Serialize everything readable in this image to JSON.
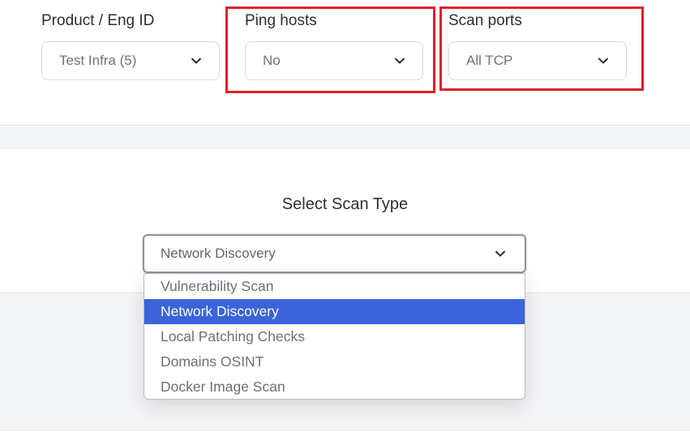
{
  "filters": {
    "product": {
      "label": "Product / Eng ID",
      "value": "Test Infra (5)"
    },
    "ping_hosts": {
      "label": "Ping hosts",
      "value": "No"
    },
    "scan_ports": {
      "label": "Scan ports",
      "value": "All TCP"
    }
  },
  "scan_type": {
    "title": "Select Scan Type",
    "selected": "Network Discovery",
    "options": [
      "Vulnerability Scan",
      "Network Discovery",
      "Local Patching Checks",
      "Domains OSINT",
      "Docker Image Scan"
    ],
    "selected_index": 1
  },
  "annotations": {
    "highlight_color": "#e0202a"
  },
  "colors": {
    "selected_option_bg": "#3a64d8",
    "panel_gap": "#f3f4f6"
  },
  "icons": {
    "dropdown": "chevron-down-icon"
  }
}
